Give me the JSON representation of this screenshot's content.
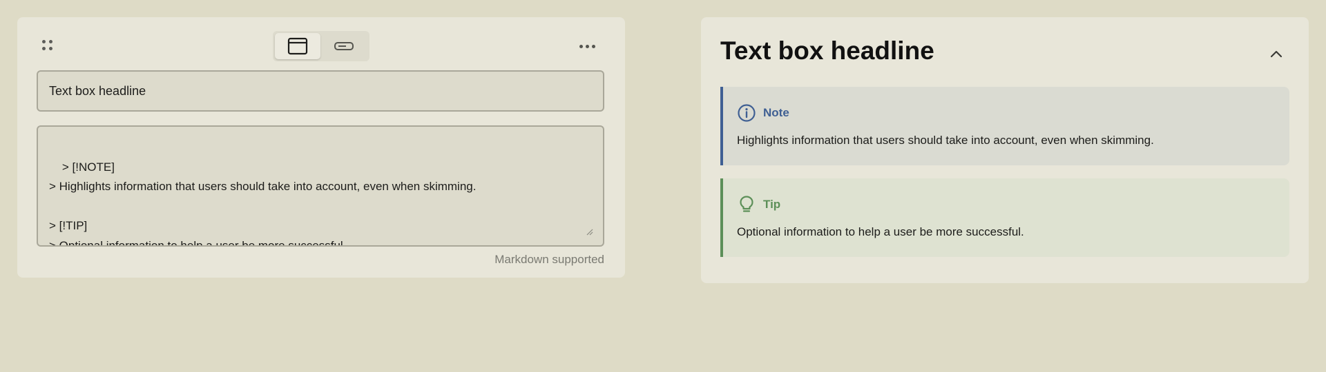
{
  "editor": {
    "view_modes": [
      "card-view",
      "inline-view"
    ],
    "headline_value": "Text box headline",
    "body_value": "> [!NOTE]\n> Highlights information that users should take into account, even when skimming.\n\n> [!TIP]\n> Optional information to help a user be more successful.",
    "markdown_note": "Markdown supported"
  },
  "preview": {
    "title": "Text box headline",
    "callouts": [
      {
        "type": "note",
        "icon": "info-icon",
        "label": "Note",
        "text": "Highlights information that users should take into account, even when skimming.",
        "color": "#3f5f93"
      },
      {
        "type": "tip",
        "icon": "lightbulb-icon",
        "label": "Tip",
        "text": "Optional information to help a user be more successful.",
        "color": "#5c8f58"
      }
    ]
  },
  "colors": {
    "background": "#dedbc6",
    "panel": "#e8e6d9",
    "note_accent": "#3f5f93",
    "tip_accent": "#5c8f58"
  }
}
